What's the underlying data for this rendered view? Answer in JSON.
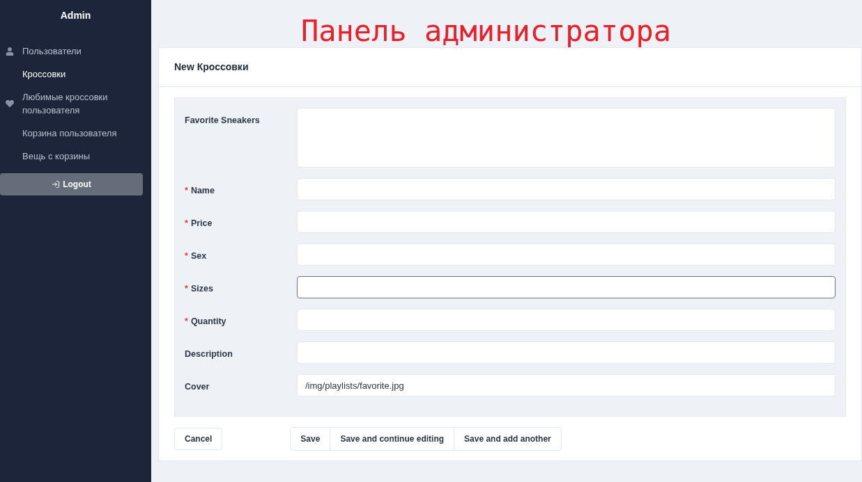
{
  "sidebar": {
    "title": "Admin",
    "items": [
      {
        "label": "Пользователи",
        "kind": "user",
        "selected": false
      },
      {
        "label": "Кроссовки",
        "kind": "plain",
        "selected": true
      },
      {
        "label": "Любимые кроссовки пользователя",
        "kind": "heart",
        "selected": false
      },
      {
        "label": "Корзина пользователя",
        "kind": "plain",
        "selected": false
      },
      {
        "label": "Вещь с корзины",
        "kind": "plain",
        "selected": false
      }
    ],
    "logout": "Logout"
  },
  "banner": "Панель администратора",
  "form": {
    "title": "New Кроссовки",
    "required_mark": "*",
    "fields": [
      {
        "label": "Favorite Sneakers",
        "kind": "textarea",
        "required": false,
        "focused": false
      },
      {
        "label": "Name",
        "kind": "input",
        "required": true,
        "focused": false
      },
      {
        "label": "Price",
        "kind": "input",
        "required": true,
        "focused": false
      },
      {
        "label": "Sex",
        "kind": "input",
        "required": true,
        "focused": false
      },
      {
        "label": "Sizes",
        "kind": "input",
        "required": true,
        "focused": true
      },
      {
        "label": "Quantity",
        "kind": "input",
        "required": true,
        "focused": false
      },
      {
        "label": "Description",
        "kind": "input",
        "required": false,
        "focused": false
      },
      {
        "label": "Cover",
        "kind": "input",
        "required": false,
        "focused": false,
        "value": "/img/playlists/favorite.jpg"
      }
    ],
    "cancel": "Cancel",
    "actions": [
      "Save",
      "Save and continue editing",
      "Save and add another"
    ]
  }
}
